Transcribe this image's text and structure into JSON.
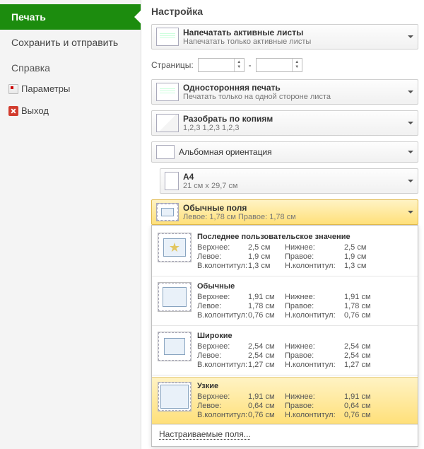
{
  "sidebar": {
    "items": [
      {
        "label": "Печать",
        "selected": true
      },
      {
        "label": "Сохранить и отправить",
        "selected": false
      }
    ],
    "section_label": "Справка",
    "sub_items": [
      {
        "label": "Параметры",
        "icon": "options-icon"
      },
      {
        "label": "Выход",
        "icon": "exit-icon"
      }
    ]
  },
  "main": {
    "heading": "Настройка",
    "print_what": {
      "title": "Напечатать активные листы",
      "desc": "Напечатать только активные листы"
    },
    "pages": {
      "label": "Страницы:",
      "from": "",
      "sep": "-",
      "to": ""
    },
    "duplex": {
      "title": "Односторонняя печать",
      "desc": "Печатать только на одной стороне листа"
    },
    "collate": {
      "title": "Разобрать по копиям",
      "desc": "1,2,3    1,2,3    1,2,3"
    },
    "orientation": {
      "title": "Альбомная ориентация"
    },
    "paper": {
      "title": "A4",
      "desc": "21 см x 29,7 см"
    },
    "margins_summary": {
      "title": "Обычные поля",
      "desc": "Левое: 1,78 см   Правое: 1,78 см"
    },
    "margins_options": {
      "last": {
        "title": "Последнее пользовательское значение",
        "top_k": "Верхнее:",
        "top_v": "2,5 см",
        "left_k": "Левое:",
        "left_v": "1,9 см",
        "hdr_k": "В.колонтитул:",
        "hdr_v": "1,3 см",
        "bot_k": "Нижнее:",
        "bot_v": "2,5 см",
        "right_k": "Правое:",
        "right_v": "1,9 см",
        "ftr_k": "Н.колонтитул:",
        "ftr_v": "1,3 см"
      },
      "normal": {
        "title": "Обычные",
        "top_k": "Верхнее:",
        "top_v": "1,91 см",
        "left_k": "Левое:",
        "left_v": "1,78 см",
        "hdr_k": "В.колонтитул:",
        "hdr_v": "0,76 см",
        "bot_k": "Нижнее:",
        "bot_v": "1,91 см",
        "right_k": "Правое:",
        "right_v": "1,78 см",
        "ftr_k": "Н.колонтитул:",
        "ftr_v": "0,76 см"
      },
      "wide": {
        "title": "Широкие",
        "top_k": "Верхнее:",
        "top_v": "2,54 см",
        "left_k": "Левое:",
        "left_v": "2,54 см",
        "hdr_k": "В.колонтитул:",
        "hdr_v": "1,27 см",
        "bot_k": "Нижнее:",
        "bot_v": "2,54 см",
        "right_k": "Правое:",
        "right_v": "2,54 см",
        "ftr_k": "Н.колонтитул:",
        "ftr_v": "1,27 см"
      },
      "narrow": {
        "title": "Узкие",
        "top_k": "Верхнее:",
        "top_v": "1,91 см",
        "left_k": "Левое:",
        "left_v": "0,64 см",
        "hdr_k": "В.колонтитул:",
        "hdr_v": "0,76 см",
        "bot_k": "Нижнее:",
        "bot_v": "1,91 см",
        "right_k": "Правое:",
        "right_v": "0,64 см",
        "ftr_k": "Н.колонтитул:",
        "ftr_v": "0,76 см"
      },
      "custom_label": "Настраиваемые поля..."
    }
  }
}
